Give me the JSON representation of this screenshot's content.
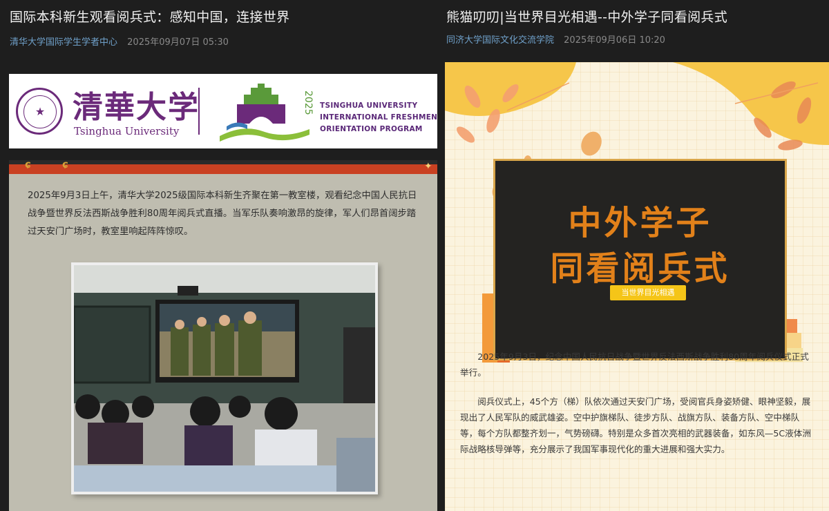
{
  "left": {
    "title": "国际本科新生观看阅兵式：感知中国，连接世界",
    "source": "清华大学国际学生学者中心",
    "date": "2025年09月07日 05:30",
    "banner": {
      "cn_name": "清華大学",
      "en_name": "Tsinghua University",
      "year": "2025",
      "program_lines": [
        "TSINGHUA UNIVERSITY",
        "INTERNATIONAL FRESHMEN",
        "ORIENTATION PROGRAM"
      ]
    },
    "paragraph": "2025年9月3日上午，清华大学2025级国际本科新生齐聚在第一教室楼，观看纪念中国人民抗日战争暨世界反法西斯战争胜利80周年阅兵式直播。当军乐队奏响激昂的旋律，军人们昂首阔步踏过天安门广场时，教室里响起阵阵惊叹。"
  },
  "right": {
    "title": "熊猫叨叨|当世界目光相遇--中外学子同看阅兵式",
    "source": "同济大学国际文化交流学院",
    "date": "2025年09月06日 10:20",
    "poster": {
      "line1": "中外学子",
      "line2": "同看阅兵式",
      "tag": "当世界目光相遇"
    },
    "paragraphs": [
      "2025年9月3日，纪念中国人民抗日战争暨世界反法西斯战争胜利80周年阅兵仪式正式举行。",
      "阅兵仪式上，45个方（梯）队依次通过天安门广场，受阅官兵身姿矫健、眼神坚毅，展现出了人民军队的威武雄姿。空中护旗梯队、徒步方队、战旗方队、装备方队、空中梯队等，每个方队都整齐划一，气势磅礴。特别是众多首次亮相的武器装备，如东风—5C液体洲际战略核导弹等，充分展示了我国军事现代化的重大进展和强大实力。"
    ]
  },
  "colors": {
    "page_bg": "#1e1e1e",
    "source_link": "#6fa0c9",
    "tsinghua_purple": "#6b2a7a",
    "poster_orange": "#e2811a",
    "tag_yellow": "#f5c518",
    "red_band": "#c94122"
  },
  "icons": [
    "tsinghua-seal-icon",
    "gate-logo-icon",
    "autumn-leaf-icon",
    "sparkle-icon",
    "book-stack-icon",
    "pencil-cup-icon"
  ]
}
